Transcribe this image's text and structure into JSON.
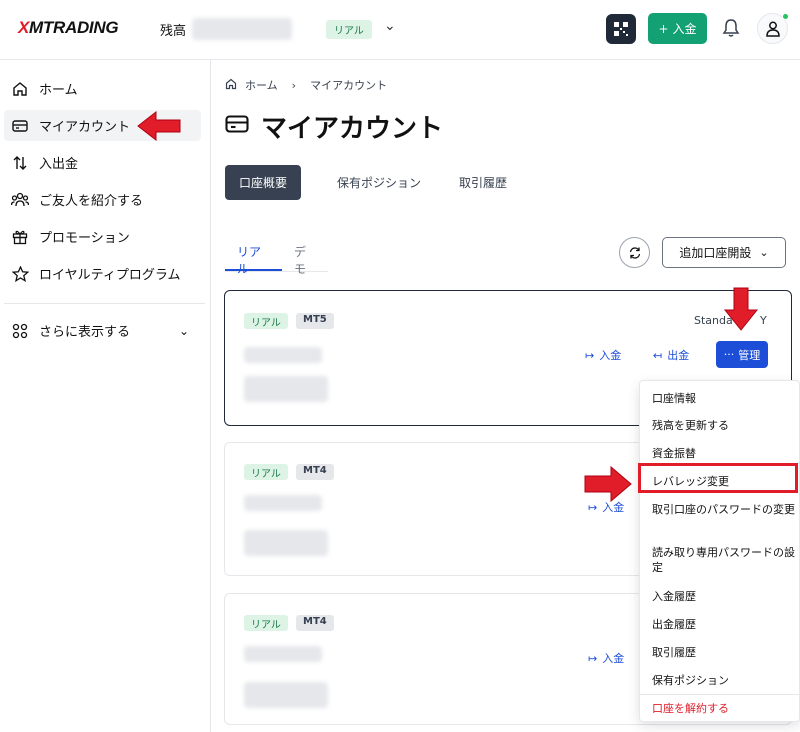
{
  "header": {
    "logo_text": "XMTRADING",
    "balance_label": "残高",
    "account_mode": "リアル",
    "deposit_label": "入金"
  },
  "sidebar": {
    "items": [
      {
        "label": "ホーム",
        "icon": "home-icon"
      },
      {
        "label": "マイアカウント",
        "icon": "wallet-icon"
      },
      {
        "label": "入出金",
        "icon": "transfer-icon"
      },
      {
        "label": "ご友人を紹介する",
        "icon": "people-icon"
      },
      {
        "label": "プロモーション",
        "icon": "gift-icon"
      },
      {
        "label": "ロイヤルティプログラム",
        "icon": "star-icon"
      }
    ],
    "more_label": "さらに表示する"
  },
  "breadcrumb": {
    "home": "ホーム",
    "current": "マイアカウント"
  },
  "page_title": "マイアカウント",
  "tabs": [
    "口座概要",
    "保有ポジション",
    "取引履歴"
  ],
  "subtabs": [
    "リアル",
    "デモ"
  ],
  "open_account_label": "追加口座開設",
  "cards": [
    {
      "mode": "リアル",
      "platform": "MT5",
      "type_label": "Standa",
      "type_tail": "Y",
      "deposit": "入金",
      "withdraw": "出金",
      "manage": "管理"
    },
    {
      "mode": "リアル",
      "platform": "MT4",
      "deposit": "入金"
    },
    {
      "mode": "リアル",
      "platform": "MT4",
      "deposit": "入金"
    }
  ],
  "manage_menu": [
    "口座情報",
    "残高を更新する",
    "資金振替",
    "レバレッジ変更",
    "取引口座のパスワードの変更",
    "読み取り専用パスワードの設定",
    "入金履歴",
    "出金履歴",
    "取引履歴",
    "保有ポジション",
    "口座を解約する"
  ],
  "colors": {
    "accent": "#1d4ed8",
    "deposit_green": "#13a073",
    "highlight_red": "#e11d2a"
  }
}
